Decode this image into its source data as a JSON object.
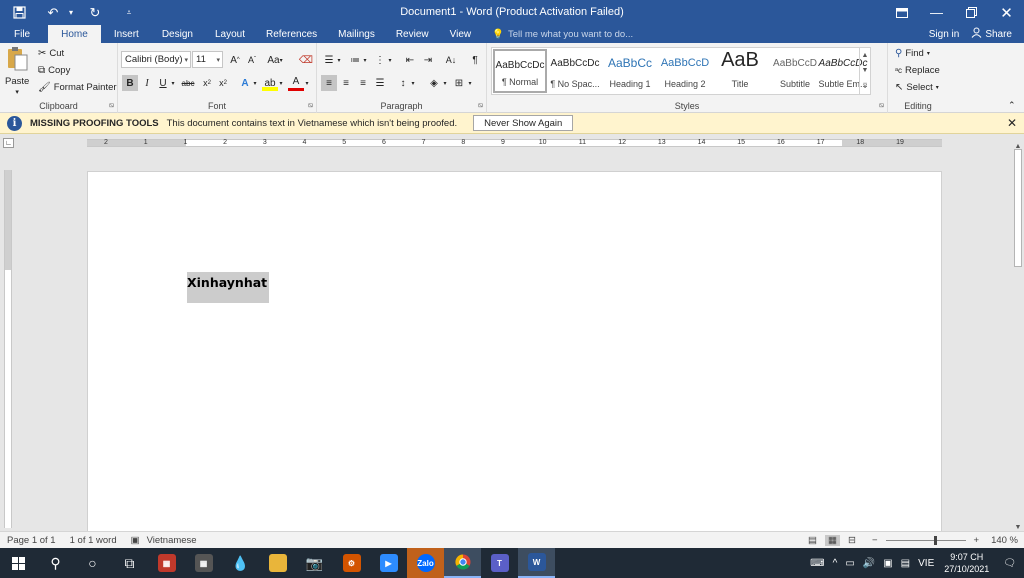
{
  "window": {
    "title": "Document1 - Word (Product Activation Failed)",
    "save_icon": "save-icon",
    "undo_icon": "undo-icon",
    "redo_icon": "redo-icon"
  },
  "tabs": [
    {
      "label": "File"
    },
    {
      "label": "Home"
    },
    {
      "label": "Insert"
    },
    {
      "label": "Design"
    },
    {
      "label": "Layout"
    },
    {
      "label": "References"
    },
    {
      "label": "Mailings"
    },
    {
      "label": "Review"
    },
    {
      "label": "View"
    }
  ],
  "tell_me": "Tell me what you want to do...",
  "sign_in": "Sign in",
  "share": "Share",
  "clipboard": {
    "paste": "Paste",
    "cut": "Cut",
    "copy": "Copy",
    "format_painter": "Format Painter",
    "label": "Clipboard"
  },
  "font": {
    "name": "Calibri (Body)",
    "size": "11",
    "change_case": "Aa",
    "label": "Font"
  },
  "paragraph": {
    "label": "Paragraph"
  },
  "styles": {
    "label": "Styles",
    "items": [
      {
        "sample": "AaBbCcDc",
        "name": "¶ Normal"
      },
      {
        "sample": "AaBbCcDc",
        "name": "¶ No Spac..."
      },
      {
        "sample": "AaBbCc",
        "name": "Heading 1"
      },
      {
        "sample": "AaBbCcD",
        "name": "Heading 2"
      },
      {
        "sample": "AaB",
        "name": "Title"
      },
      {
        "sample": "AaBbCcD",
        "name": "Subtitle"
      },
      {
        "sample": "AaBbCcDc",
        "name": "Subtle Em..."
      }
    ]
  },
  "editing": {
    "find": "Find",
    "replace": "Replace",
    "select": "Select",
    "label": "Editing"
  },
  "message_bar": {
    "title": "MISSING PROOFING TOOLS",
    "text": "This document contains text in Vietnamese which isn't being proofed.",
    "button": "Never Show Again"
  },
  "ruler": {
    "h_numbers": [
      "2",
      "1",
      "1",
      "2",
      "3",
      "4",
      "5",
      "6",
      "7",
      "8",
      "9",
      "10",
      "11",
      "12",
      "13",
      "14",
      "15",
      "16",
      "17",
      "18",
      "19"
    ]
  },
  "document": {
    "text": "Xinhaynhat"
  },
  "status": {
    "page": "Page 1 of 1",
    "words": "1 of 1 word",
    "language": "Vietnamese",
    "zoom": "140 %"
  },
  "taskbar": {
    "language": "VIE",
    "time": "9:07 CH",
    "date": "27/10/2021"
  }
}
